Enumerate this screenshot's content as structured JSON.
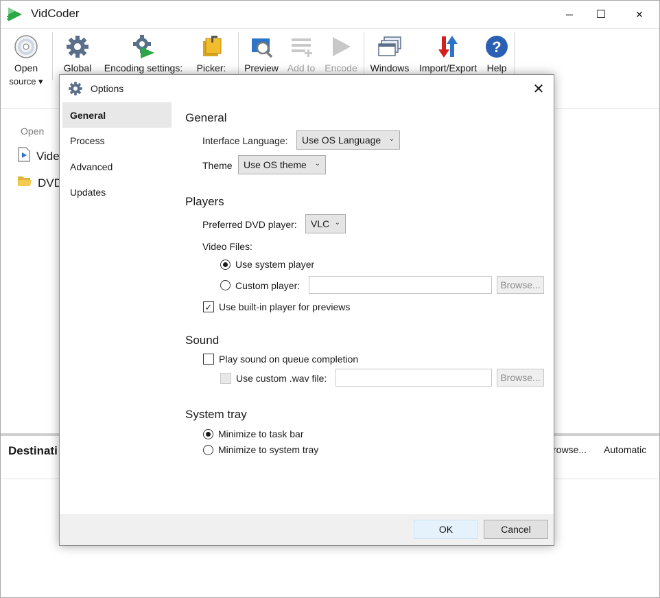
{
  "app": {
    "title": "VidCoder",
    "colors": {
      "accent": "#0078d7",
      "brand_green": "#2ca646"
    }
  },
  "window_controls": {
    "minimize": "─",
    "maximize": "☐",
    "close": "✕"
  },
  "toolbar": {
    "items": [
      {
        "label": "Open\nsource ▾",
        "icon": "disc-icon"
      },
      {
        "label": "Global",
        "icon": "gear-icon"
      },
      {
        "label": "Encoding settings:",
        "icon": "encoding-gear-icon"
      },
      {
        "label": "Picker:",
        "icon": "picker-icon"
      },
      {
        "label": "Preview",
        "icon": "preview-icon"
      },
      {
        "label": "Add to",
        "icon": "add-to-queue-icon",
        "disabled": true
      },
      {
        "label": "Encode",
        "icon": "play-icon",
        "disabled": true
      },
      {
        "label": "Windows",
        "icon": "windows-icon"
      },
      {
        "label": "Import/Export",
        "icon": "import-export-icon"
      },
      {
        "label": "Help",
        "icon": "help-icon"
      }
    ],
    "open_line1": "Open",
    "open_line2": "source ▾"
  },
  "open_panel": {
    "heading": "Open",
    "rows": [
      {
        "label": "Vide",
        "icon": "video-file-icon"
      },
      {
        "label": "DVD",
        "icon": "folder-icon"
      }
    ]
  },
  "destination": {
    "label": "Destinati",
    "browse": "rowse...",
    "automatic": "Automatic"
  },
  "dialog": {
    "title": "Options",
    "close": "✕",
    "nav": [
      {
        "label": "General",
        "selected": true
      },
      {
        "label": "Process",
        "selected": false
      },
      {
        "label": "Advanced",
        "selected": false
      },
      {
        "label": "Updates",
        "selected": false
      }
    ],
    "general": {
      "heading": "General",
      "interface_language_label": "Interface Language:",
      "interface_language_value": "Use OS Language",
      "theme_label": "Theme",
      "theme_value": "Use OS theme"
    },
    "players": {
      "heading": "Players",
      "dvd_player_label": "Preferred DVD player:",
      "dvd_player_value": "VLC",
      "video_files_label": "Video Files:",
      "use_system_player": "Use system player",
      "use_system_player_checked": true,
      "custom_player": "Custom player:",
      "custom_player_checked": false,
      "custom_player_value": "",
      "browse": "Browse...",
      "builtin_player_label": "Use built-in player for previews",
      "builtin_player_checked": true
    },
    "sound": {
      "heading": "Sound",
      "play_sound_label": "Play sound on queue completion",
      "play_sound_checked": false,
      "custom_wav_label": "Use custom .wav file:",
      "custom_wav_checked": false,
      "custom_wav_value": "",
      "browse": "Browse..."
    },
    "system_tray": {
      "heading": "System tray",
      "minimize_taskbar": "Minimize to task bar",
      "minimize_taskbar_checked": true,
      "minimize_tray": "Minimize to system tray",
      "minimize_tray_checked": false
    },
    "buttons": {
      "ok": "OK",
      "cancel": "Cancel"
    }
  }
}
